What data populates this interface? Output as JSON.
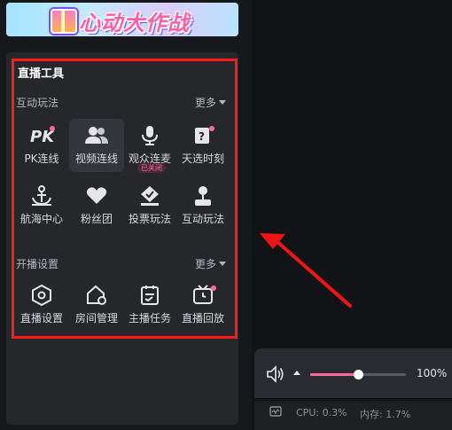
{
  "banner": {
    "title": "心动大作战"
  },
  "panel": {
    "title": "直播工具",
    "section1": {
      "label": "互动玩法",
      "more": "更多",
      "items": [
        {
          "label": "PK连线",
          "icon": "pk-icon"
        },
        {
          "label": "视频连线",
          "icon": "users-icon"
        },
        {
          "label": "观众连麦",
          "icon": "microphone-icon",
          "badge": "已关闭"
        },
        {
          "label": "天选时刻",
          "icon": "lucky-card-icon"
        },
        {
          "label": "航海中心",
          "icon": "anchor-icon"
        },
        {
          "label": "粉丝团",
          "icon": "heart-group-icon"
        },
        {
          "label": "投票玩法",
          "icon": "vote-icon"
        },
        {
          "label": "互动玩法",
          "icon": "joystick-icon"
        }
      ]
    },
    "section2": {
      "label": "开播设置",
      "more": "更多",
      "items": [
        {
          "label": "直播设置",
          "icon": "hex-settings-icon"
        },
        {
          "label": "房间管理",
          "icon": "house-settings-icon"
        },
        {
          "label": "主播任务",
          "icon": "task-list-icon"
        },
        {
          "label": "直播回放",
          "icon": "tv-replay-icon"
        }
      ]
    }
  },
  "controls": {
    "volume": "100%",
    "volume_level": 0.5
  },
  "status": {
    "cpu": "CPU: 0.3%",
    "memory": "内存: 1.7%"
  },
  "colors": {
    "accent": "#ff6a9a",
    "highlight_box": "#ff1a1a"
  }
}
